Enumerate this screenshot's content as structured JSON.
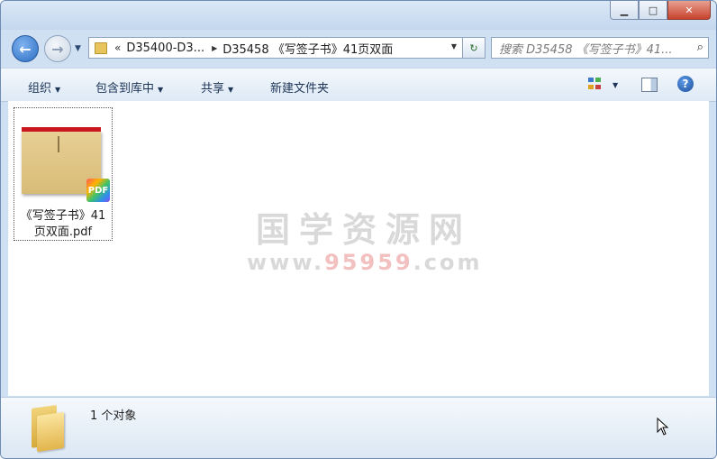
{
  "window": {
    "controls": {
      "minimize": "▁",
      "maximize": "□",
      "close": "✕"
    }
  },
  "navigation": {
    "back_glyph": "←",
    "forward_glyph": "→",
    "address": {
      "overflow": "«",
      "segments": [
        "D35400-D3...",
        "D35458 《写签子书》41页双面"
      ]
    },
    "refresh_glyph": "↻",
    "search": {
      "placeholder": "搜索 D35458 《写签子书》41..."
    }
  },
  "toolbar": {
    "items": [
      "组织",
      "包含到库中",
      "共享",
      "新建文件夹"
    ],
    "help_glyph": "?"
  },
  "files": [
    {
      "name_line1": "《写签子书》41",
      "name_line2": "页双面.pdf",
      "badge": "PDF",
      "thumb_header": "PDF"
    }
  ],
  "watermark": {
    "title": "国学资源网",
    "url_prefix": "www.",
    "url_number": "95959",
    "url_suffix": ".com"
  },
  "details": {
    "status": "1 个对象"
  },
  "colors": {
    "accent": "#2c6ec4",
    "close": "#c8432e",
    "pdf_header": "#c8171e"
  }
}
